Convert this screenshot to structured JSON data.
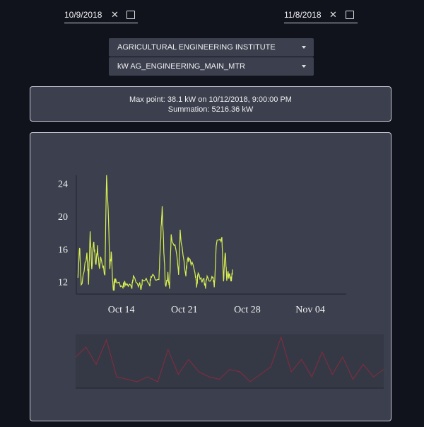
{
  "controls": {
    "start_date": "10/9/2018",
    "end_date": "11/8/2018",
    "clear_glyph": "✕",
    "building": "AGRICULTURAL ENGINEERING INSTITUTE",
    "meter": "kW AG_ENGINEERING_MAIN_MTR"
  },
  "summary": {
    "max_point": "Max point: 38.1 kW on 10/12/2018, 9:00:00 PM",
    "summation": "Summation: 5216.36 kW"
  },
  "colors": {
    "background": "#10131c",
    "panel": "#3b3f4e",
    "main_line": "#d8ef52",
    "overview_line": "#8a2a3c"
  },
  "icons": [
    "clear-icon",
    "checkbox-icon",
    "caret-down-icon"
  ],
  "chart_data": {
    "type": "line",
    "title": "",
    "xlabel": "",
    "ylabel": "",
    "y_ticks": [
      12,
      16,
      20,
      24
    ],
    "x_ticks": [
      "Oct 14",
      "Oct 21",
      "Oct 28",
      "Nov 04"
    ],
    "x_tick_dates": [
      "2018-10-14",
      "2018-10-21",
      "2018-10-28",
      "2018-11-04"
    ],
    "ylim": [
      10.5,
      25
    ],
    "xlim": [
      "2018-10-09",
      "2018-11-08"
    ],
    "series": [
      {
        "x": [
          "2018-10-09",
          "2018-10-09",
          "2018-10-09",
          "2018-10-10",
          "2018-10-10",
          "2018-10-10",
          "2018-10-10",
          "2018-10-10",
          "2018-10-11",
          "2018-10-11",
          "2018-10-11",
          "2018-10-11",
          "2018-10-12",
          "2018-10-12",
          "2018-10-12",
          "2018-10-12",
          "2018-10-12",
          "2018-10-12",
          "2018-10-12",
          "2018-10-13",
          "2018-10-13",
          "2018-10-14",
          "2018-10-14",
          "2018-10-15",
          "2018-10-15",
          "2018-10-16",
          "2018-10-16",
          "2018-10-17",
          "2018-10-17",
          "2018-10-18",
          "2018-10-18",
          "2018-10-18",
          "2018-10-18",
          "2018-10-18",
          "2018-10-19",
          "2018-10-19",
          "2018-10-19",
          "2018-10-20",
          "2018-10-20",
          "2018-10-20",
          "2018-10-21",
          "2018-10-21",
          "2018-10-21",
          "2018-10-22",
          "2018-10-22",
          "2018-10-22",
          "2018-10-23",
          "2018-10-23",
          "2018-10-23",
          "2018-10-24",
          "2018-10-24",
          "2018-10-24",
          "2018-10-25",
          "2018-10-25",
          "2018-10-25",
          "2018-10-25",
          "2018-10-25",
          "2018-10-26",
          "2018-10-26"
        ],
        "values": [
          12.5,
          16.5,
          11.5,
          15.5,
          12.0,
          18.0,
          13.5,
          17.0,
          14.0,
          16.5,
          13.5,
          15.0,
          13.0,
          24.8,
          21.0,
          14.0,
          15.5,
          11.0,
          12.2,
          11.3,
          12.4,
          11.5,
          12.0,
          11.6,
          12.5,
          11.4,
          12.3,
          11.8,
          12.6,
          12.0,
          17.0,
          21.0,
          16.0,
          11.5,
          12.8,
          11.4,
          17.5,
          15.5,
          13.0,
          18.0,
          13.0,
          15.0,
          14.5,
          13.5,
          11.5,
          12.8,
          12.0,
          11.5,
          12.6,
          12.2,
          11.6,
          16.5,
          17.5,
          12.0,
          16.0,
          12.5,
          13.0,
          12.0,
          13.5
        ]
      }
    ],
    "overview": {
      "type": "line",
      "x": [
        "2018-10-09",
        "2018-10-10",
        "2018-10-11",
        "2018-10-12",
        "2018-10-13",
        "2018-10-14",
        "2018-10-15",
        "2018-10-16",
        "2018-10-17",
        "2018-10-18",
        "2018-10-19",
        "2018-10-20",
        "2018-10-21",
        "2018-10-22",
        "2018-10-23",
        "2018-10-24",
        "2018-10-25",
        "2018-10-26",
        "2018-10-27",
        "2018-10-28",
        "2018-10-29",
        "2018-10-30",
        "2018-10-31",
        "2018-11-01",
        "2018-11-02",
        "2018-11-03",
        "2018-11-04",
        "2018-11-05",
        "2018-11-06",
        "2018-11-07",
        "2018-11-08"
      ],
      "values": [
        0.6,
        0.8,
        0.45,
        0.95,
        0.2,
        0.15,
        0.1,
        0.2,
        0.1,
        0.75,
        0.25,
        0.55,
        0.3,
        0.2,
        0.15,
        0.35,
        0.3,
        0.1,
        0.25,
        0.4,
        1.0,
        0.3,
        0.55,
        0.2,
        0.7,
        0.25,
        0.6,
        0.15,
        0.45,
        0.2,
        0.35
      ]
    }
  }
}
